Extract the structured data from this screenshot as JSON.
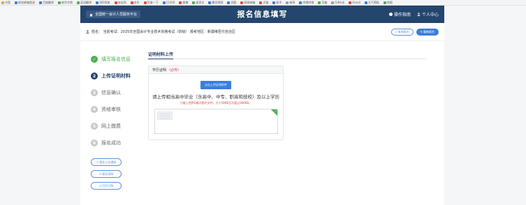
{
  "bookmarks": [
    {
      "label": "书签",
      "color": "#f0a020"
    },
    {
      "label": "新浪邮箱登录",
      "color": "#3b7ddd"
    },
    {
      "label": "百度翻译",
      "color": "#3b7ddd"
    },
    {
      "label": "新华字典",
      "color": "#4caf50"
    },
    {
      "label": "英语翻译",
      "color": "#4caf50"
    },
    {
      "label": "360导航",
      "color": "#3b7ddd"
    },
    {
      "label": "淘宝网",
      "color": "#e74c3c"
    },
    {
      "label": "京东",
      "color": "#e74c3c"
    },
    {
      "label": "百度一下",
      "color": "#e74c3c"
    },
    {
      "label": "12306",
      "color": "#3b7ddd"
    },
    {
      "label": "微博",
      "color": "#e74c3c"
    },
    {
      "label": "爱奇艺",
      "color": "#4caf50"
    },
    {
      "label": "腾讯视频",
      "color": "#3b7ddd"
    },
    {
      "label": "优酷",
      "color": "#3b7ddd"
    },
    {
      "label": "网易邮箱",
      "color": "#e74c3c"
    },
    {
      "label": "天猫",
      "color": "#e74c3c"
    },
    {
      "label": "知乎",
      "color": "#3b7ddd"
    },
    {
      "label": "新闻",
      "color": "#9aa0a6"
    },
    {
      "label": "哔哩哔哩",
      "color": "#3b7ddd"
    },
    {
      "label": "豆瓣",
      "color": "#4caf50"
    },
    {
      "label": "GitHub",
      "color": "#9aa0a6"
    },
    {
      "label": "Gmail",
      "color": "#e74c3c"
    },
    {
      "label": "天气预报",
      "color": "#3b7ddd"
    },
    {
      "label": "地图",
      "color": "#4caf50"
    }
  ],
  "topbar": {
    "home_label": "全国统一会计人员服务平台",
    "title": "报名信息填写",
    "guide_label": "操作指南",
    "user_center_label": "个人中心"
  },
  "infobar": {
    "text": "姓名：        当前考试：2025年全国会计专业技术资格考试（初级）   报考地区：新疆维吾尔自治区",
    "query_button": "查询报名",
    "reset_button": "重新报名"
  },
  "steps": [
    {
      "num": "✓",
      "label": "填写报名信息",
      "state": "done"
    },
    {
      "num": "2",
      "label": "上传证明材料",
      "state": "active"
    },
    {
      "num": "3",
      "label": "信息确认",
      "state": "pending"
    },
    {
      "num": "4",
      "label": "资格审核",
      "state": "pending"
    },
    {
      "num": "5",
      "label": "网上缴费",
      "state": "pending"
    },
    {
      "num": "6",
      "label": "报名成功",
      "state": "pending"
    }
  ],
  "side_links": [
    {
      "label": "相关公告通知"
    },
    {
      "label": "报名须知"
    },
    {
      "label": "打印订购"
    }
  ],
  "content": {
    "section_title": "证明材料上传",
    "card_title": "学历证明",
    "card_required": "（必传）",
    "upload_button": "点击上传证明附件",
    "hint_main": "请上传相当高中毕业（含高中、中专、职高和技校）及以上学历",
    "hint_sub": "只能上传JPG格式图片文件，大于50KB且不超过300KB。"
  },
  "colors": {
    "topbar_bg": "#24456e",
    "accent": "#3b7ddd",
    "done": "#4caf50",
    "required": "#e53935"
  }
}
